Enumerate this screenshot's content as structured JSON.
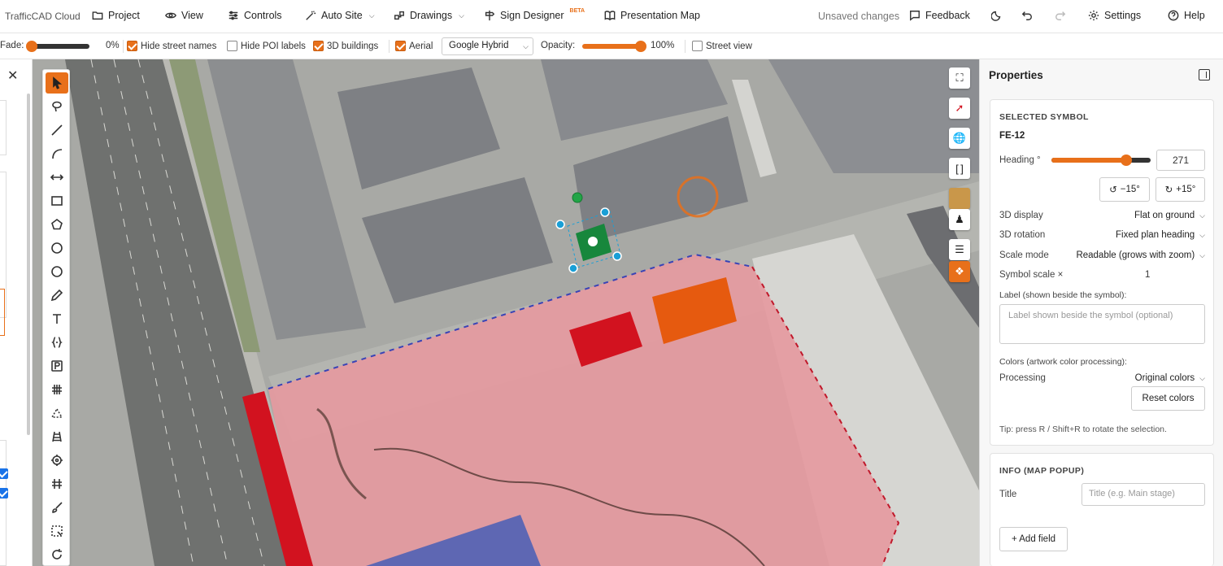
{
  "app": {
    "brand": "TrafficCAD Cloud"
  },
  "menu": {
    "project": "Project",
    "view": "View",
    "controls": "Controls",
    "auto_site": "Auto Site",
    "drawings": "Drawings",
    "sign_designer": "Sign Designer",
    "beta": "BETA",
    "presentation_map": "Presentation Map",
    "unsaved": "Unsaved changes",
    "feedback": "Feedback",
    "settings": "Settings",
    "help": "Help"
  },
  "toolbar2": {
    "fade_label": "Fade:",
    "fade_value": "0%",
    "fade_level": 0,
    "hide_street_names": {
      "label": "Hide street names",
      "checked": true
    },
    "hide_poi_labels": {
      "label": "Hide POI labels",
      "checked": false
    },
    "buildings_3d": {
      "label": "3D buildings",
      "checked": true
    },
    "aerial": {
      "label": "Aerial",
      "checked": true
    },
    "basemap": "Google Hybrid",
    "opacity_label": "Opacity:",
    "opacity_value": "100%",
    "opacity_level": 1.0,
    "street_view": {
      "label": "Street view",
      "checked": false
    }
  },
  "map_buttons": [
    "fullscreen-icon",
    "compass-icon",
    "globe-icon",
    "bracket-icon",
    "aerial-thumb-icon",
    "pegman-icon",
    "layers-icon",
    "location-icon"
  ],
  "properties": {
    "title": "Properties",
    "selected_header": "SELECTED SYMBOL",
    "symbol_id": "FE-12",
    "heading_label": "Heading °",
    "heading_value": "271",
    "heading_level": 0.75,
    "rot_minus": "−15°",
    "rot_plus": "+15°",
    "display_3d_label": "3D display",
    "display_3d_value": "Flat on ground",
    "rotation_3d_label": "3D rotation",
    "rotation_3d_value": "Fixed plan heading",
    "scale_mode_label": "Scale mode",
    "scale_mode_value": "Readable (grows with zoom)",
    "symbol_scale_label": "Symbol scale ×",
    "symbol_scale_value": "1",
    "label_field_label": "Label (shown beside the symbol):",
    "label_placeholder": "Label shown beside the symbol (optional)",
    "colors_label": "Colors (artwork color processing):",
    "processing_label": "Processing",
    "processing_value": "Original colors",
    "reset_colors": "Reset colors",
    "tip": "Tip: press R / Shift+R to rotate the selection.",
    "info_header": "INFO (MAP POPUP)",
    "info_title_label": "Title",
    "info_title_placeholder": "Title (e.g. Main stage)",
    "add_field": "+ Add field"
  },
  "colors": {
    "accent": "#e8701a",
    "selection": "#1a9fd6",
    "zone_fill": "#e99aa0",
    "red_block": "#d2121f",
    "orange_block": "#e65a0f",
    "green_sign": "#17873c"
  }
}
